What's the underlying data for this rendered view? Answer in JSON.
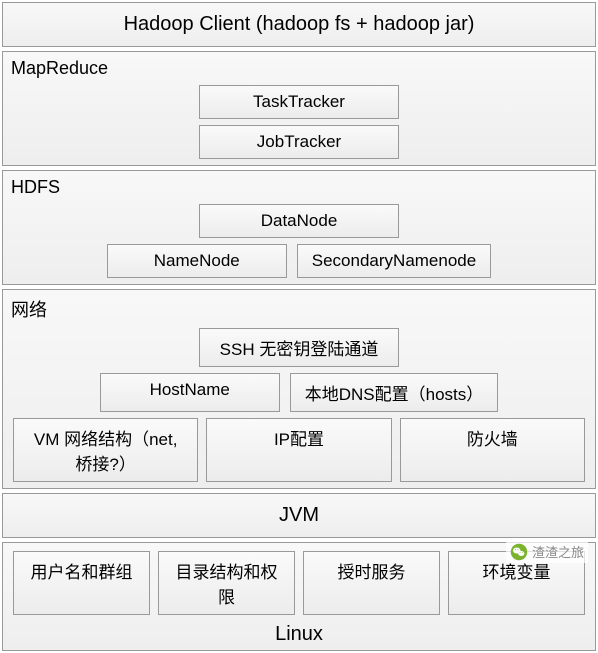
{
  "client": {
    "title": "Hadoop Client (hadoop fs + hadoop jar)"
  },
  "mapreduce": {
    "title": "MapReduce",
    "tasktracker": "TaskTracker",
    "jobtracker": "JobTracker"
  },
  "hdfs": {
    "title": "HDFS",
    "datanode": "DataNode",
    "namenode": "NameNode",
    "secondary": "SecondaryNamenode"
  },
  "network": {
    "title": "网络",
    "ssh": "SSH 无密钥登陆通道",
    "hostname": "HostName",
    "dns": "本地DNS配置（hosts）",
    "vm": "VM 网络结构（net,桥接?）",
    "ip": "IP配置",
    "firewall": "防火墙"
  },
  "jvm": {
    "title": "JVM"
  },
  "linux": {
    "title": "Linux",
    "user": "用户名和群组",
    "dir": "目录结构和权限",
    "time": "授时服务",
    "env": "环境变量"
  },
  "watermark": {
    "text": "渣渣之旅"
  }
}
